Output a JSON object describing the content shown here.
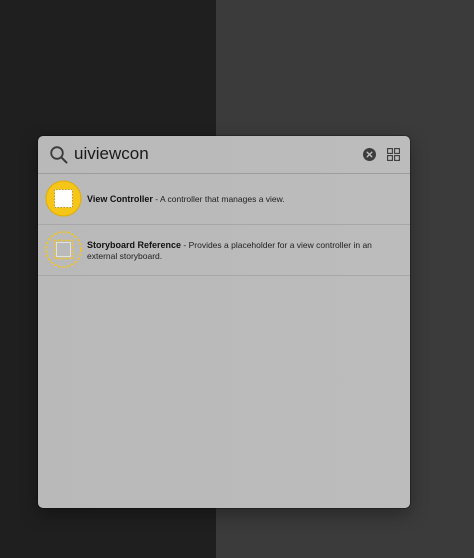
{
  "search": {
    "value": "uiviewcon",
    "icon": "magnifier-icon",
    "clear_icon": "clear-x-icon",
    "view_toggle_icon": "grid-view-icon"
  },
  "results": [
    {
      "title": "View Controller",
      "separator": " - ",
      "description": "A controller that manages a view.",
      "icon": "view-controller-icon",
      "icon_color": "#f5c518"
    },
    {
      "title": "Storyboard Reference",
      "separator": " - ",
      "description": "Provides a placeholder for a view controller in an external storyboard.",
      "icon": "storyboard-reference-icon",
      "icon_color": "#f5c518"
    }
  ],
  "colors": {
    "panel_bg": "#bababa",
    "accent_yellow": "#f5c518",
    "left_bg": "#1f1f1f",
    "right_bg": "#3b3b3b"
  }
}
